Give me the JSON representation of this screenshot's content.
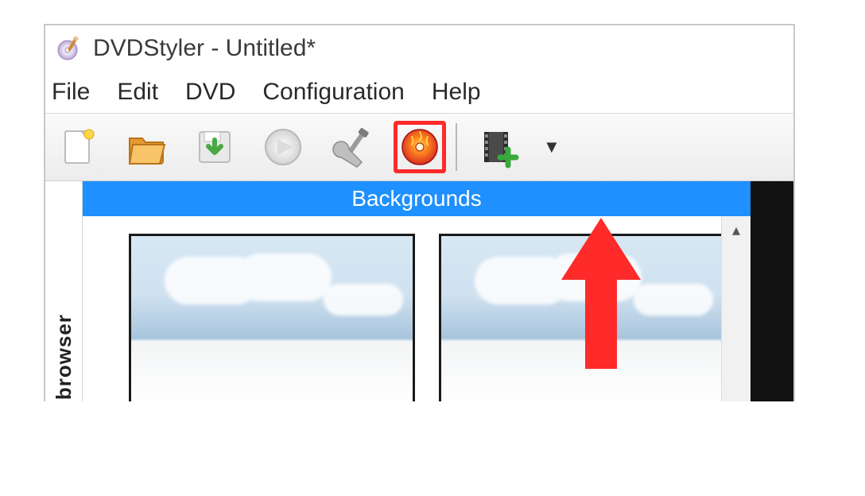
{
  "title": "DVDStyler - Untitled*",
  "menu": [
    "File",
    "Edit",
    "DVD",
    "Configuration",
    "Help"
  ],
  "toolbar": {
    "buttons": [
      {
        "name": "new-project-button",
        "icon": "new-file-icon"
      },
      {
        "name": "open-project-button",
        "icon": "open-folder-icon"
      },
      {
        "name": "save-project-button",
        "icon": "save-icon"
      },
      {
        "name": "preview-button",
        "icon": "disc-preview-icon"
      },
      {
        "name": "settings-button",
        "icon": "wrench-screwdriver-icon"
      },
      {
        "name": "burn-disc-button",
        "icon": "burn-disc-icon",
        "highlighted": true
      },
      {
        "name": "add-video-button",
        "icon": "film-add-icon"
      }
    ]
  },
  "side_tab_label": "browser",
  "backgrounds_header": "Backgrounds",
  "annotation": {
    "color": "#ff2a2a",
    "target": "burn-disc-button",
    "shape": "arrow-up"
  }
}
